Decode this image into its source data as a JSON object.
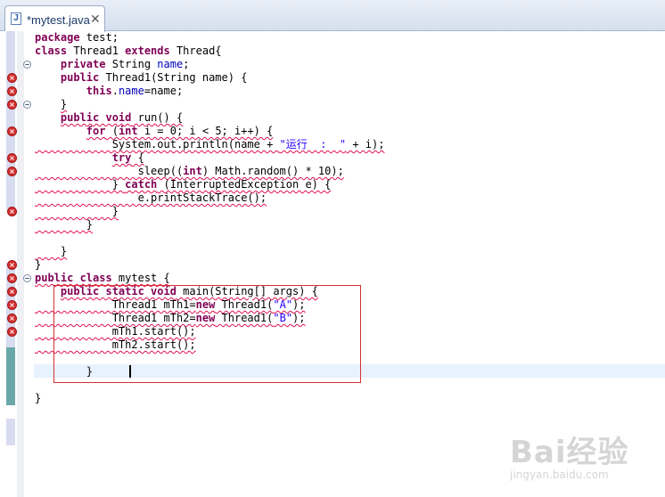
{
  "tab": {
    "title": "*mytest.java",
    "close": "✕",
    "icon_letter": "J",
    "icon": "java-file-icon"
  },
  "lines": [
    [
      {
        "t": "package",
        "k": 1
      },
      {
        "t": " test;"
      }
    ],
    [
      {
        "t": "class",
        "k": 1
      },
      {
        "t": " Thread1 "
      },
      {
        "t": "extends",
        "k": 1
      },
      {
        "t": " Thread{"
      }
    ],
    [
      {
        "t": "    "
      },
      {
        "t": "private",
        "k": 1
      },
      {
        "t": " String "
      },
      {
        "t": "name",
        "f": 1
      },
      {
        "t": ";"
      }
    ],
    [
      {
        "t": "    "
      },
      {
        "t": "public",
        "k": 1
      },
      {
        "t": " Thread1(String name) {"
      }
    ],
    [
      {
        "t": "        "
      },
      {
        "t": "this",
        "k": 1
      },
      {
        "t": "."
      },
      {
        "t": "name",
        "f": 1
      },
      {
        "t": "=name;"
      }
    ],
    [
      {
        "t": "    "
      },
      {
        "t": "}",
        "sq": 1
      }
    ],
    [
      {
        "t": "    "
      },
      {
        "t": "public void",
        "k": 1,
        "sq": 1
      },
      {
        "t": " run() {",
        "sq": 1
      }
    ],
    [
      {
        "t": "        "
      },
      {
        "t": "for",
        "k": 1,
        "sq": 1
      },
      {
        "t": " (",
        "sq": 1
      },
      {
        "t": "int",
        "k": 1,
        "sq": 1
      },
      {
        "t": " i = 0; i < 5; i++) {",
        "sq": 1
      }
    ],
    [
      {
        "t": "            System.out.println(name + ",
        "sq": 1
      },
      {
        "t": "\"运行  :  \"",
        "s": 1,
        "sq": 1
      },
      {
        "t": " + i);",
        "sq": 1
      }
    ],
    [
      {
        "t": "            "
      },
      {
        "t": "try",
        "k": 1,
        "sq": 1
      },
      {
        "t": " {",
        "sq": 1
      }
    ],
    [
      {
        "t": "                sleep((",
        "sq": 1
      },
      {
        "t": "int",
        "k": 1,
        "sq": 1
      },
      {
        "t": ") Math.random() * 10);",
        "sq": 1
      }
    ],
    [
      {
        "t": "            } ",
        "sq": 1
      },
      {
        "t": "catch",
        "k": 1,
        "sq": 1
      },
      {
        "t": " (InterruptedException e) {",
        "sq": 1
      }
    ],
    [
      {
        "t": "                e.printStackTrace();",
        "sq": 1
      }
    ],
    [
      {
        "t": "            }",
        "sq": 1
      }
    ],
    [
      {
        "t": "        }",
        "sq": 1
      }
    ],
    [
      {
        "t": ""
      }
    ],
    [
      {
        "t": "    }",
        "sq": 1
      }
    ],
    [
      {
        "t": "}"
      }
    ],
    [
      {
        "t": "public class",
        "k": 1,
        "sq": 1
      },
      {
        "t": " mytest {",
        "sq": 1
      }
    ],
    [
      {
        "t": "    "
      },
      {
        "t": "public static void",
        "k": 1,
        "sq": 1
      },
      {
        "t": " main(String[] args) {",
        "sq": 1
      }
    ],
    [
      {
        "t": "            Thread1 mTh1=",
        "sq": 1
      },
      {
        "t": "new",
        "k": 1,
        "sq": 1
      },
      {
        "t": " Thread1(",
        "sq": 1
      },
      {
        "t": "\"A\"",
        "s": 1,
        "sq": 1
      },
      {
        "t": ");",
        "sq": 1
      }
    ],
    [
      {
        "t": "            Thread1 mTh2=",
        "sq": 1
      },
      {
        "t": "new",
        "k": 1,
        "sq": 1
      },
      {
        "t": " Thread1(",
        "sq": 1
      },
      {
        "t": "\"B\"",
        "s": 1,
        "sq": 1
      },
      {
        "t": ");",
        "sq": 1
      }
    ],
    [
      {
        "t": "            mTh1.start();",
        "sq": 1
      }
    ],
    [
      {
        "t": "            mTh2.start();",
        "sq": 1
      }
    ],
    [
      {
        "t": ""
      }
    ],
    [
      {
        "t": "        }  "
      }
    ],
    [
      {
        "t": ""
      }
    ],
    [
      {
        "t": "}"
      }
    ]
  ],
  "error_lines": [
    4,
    5,
    6,
    8,
    10,
    11,
    14,
    18,
    19,
    20,
    21,
    22,
    23
  ],
  "fold_lines": [
    3,
    6,
    19
  ],
  "gutter": {
    "error_icon": "error-marker-icon",
    "fold_icon": "fold-collapse-icon"
  },
  "watermark": {
    "main": "Bai经验",
    "sub": "jingyan.baidu.com"
  }
}
